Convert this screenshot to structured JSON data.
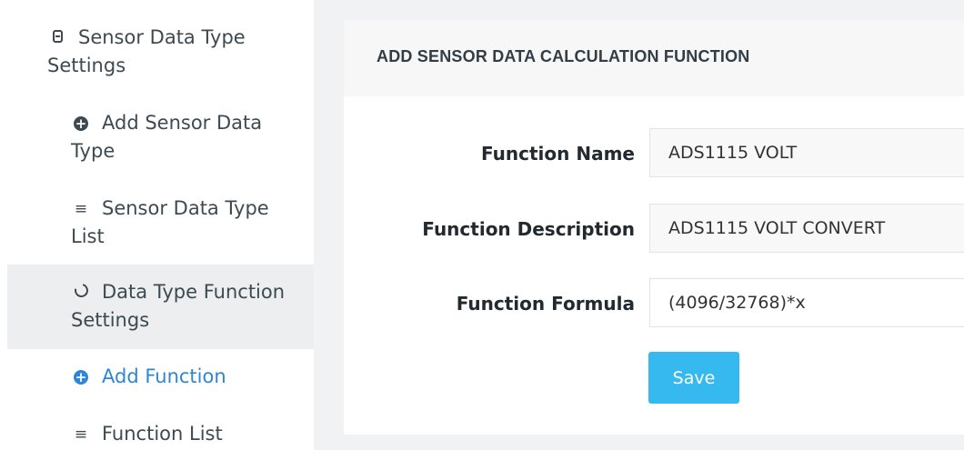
{
  "sidebar": {
    "items": [
      {
        "icon": "database-icon",
        "label": "Sensor Data Type Settings"
      },
      {
        "icon": "plus-circle-icon",
        "label": "Add Sensor Data Type"
      },
      {
        "icon": "list-icon",
        "label": "Sensor Data Type List"
      },
      {
        "icon": "refresh-icon",
        "label": "Data Type Function Settings"
      },
      {
        "icon": "plus-circle-icon",
        "label": "Add Function"
      },
      {
        "icon": "list-icon",
        "label": "Function List"
      }
    ],
    "active_index": 3,
    "selected_index": 4,
    "accent_color": "#2e86d6"
  },
  "card": {
    "title": "ADD SENSOR DATA CALCULATION FUNCTION",
    "fields": [
      {
        "label": "Function Name",
        "value": "ADS1115 VOLT"
      },
      {
        "label": "Function Description",
        "value": "ADS1115 VOLT CONVERT"
      },
      {
        "label": "Function Formula",
        "value": "(4096/32768)*x"
      }
    ],
    "save_label": "Save",
    "save_color": "#36b9ee"
  }
}
